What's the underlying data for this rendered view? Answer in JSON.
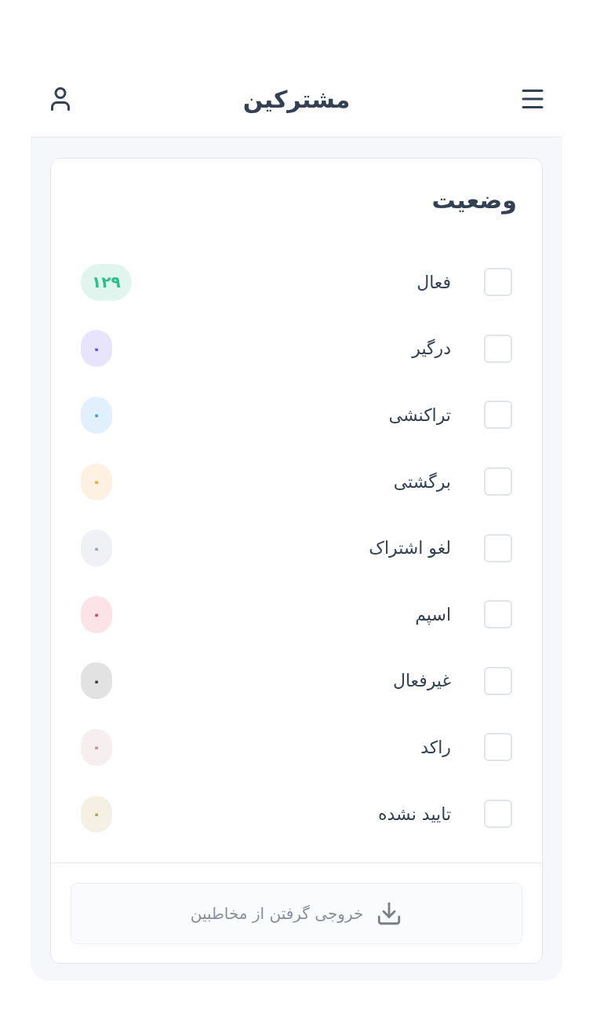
{
  "header": {
    "title": "مشترکین"
  },
  "filter": {
    "title": "وضعیت",
    "items": [
      {
        "label": "فعال",
        "checked": false,
        "count": "۱۲۹",
        "color": "#2bbf8e"
      },
      {
        "label": "درگیر",
        "checked": false,
        "count": "۰",
        "color": "#6a4cf4"
      },
      {
        "label": "تراکنشی",
        "checked": false,
        "count": "۰",
        "color": "#3b9af5"
      },
      {
        "label": "برگشتی",
        "checked": false,
        "count": "۰",
        "color": "#f59e3a"
      },
      {
        "label": "لغو اشتراک",
        "checked": false,
        "count": "۰",
        "color": "#94a3b8"
      },
      {
        "label": "اسپم",
        "checked": false,
        "count": "۰",
        "color": "#e5405e"
      },
      {
        "label": "غیرفعال",
        "checked": false,
        "count": "۰",
        "color": "#3a3a3a"
      },
      {
        "label": "راکد",
        "checked": false,
        "count": "۰",
        "color": "#c98f99"
      },
      {
        "label": "تایید نشده",
        "checked": false,
        "count": "۰",
        "color": "#b3a24c"
      }
    ]
  },
  "export_button": {
    "label": "خروجی گرفتن از مخاطبین"
  }
}
